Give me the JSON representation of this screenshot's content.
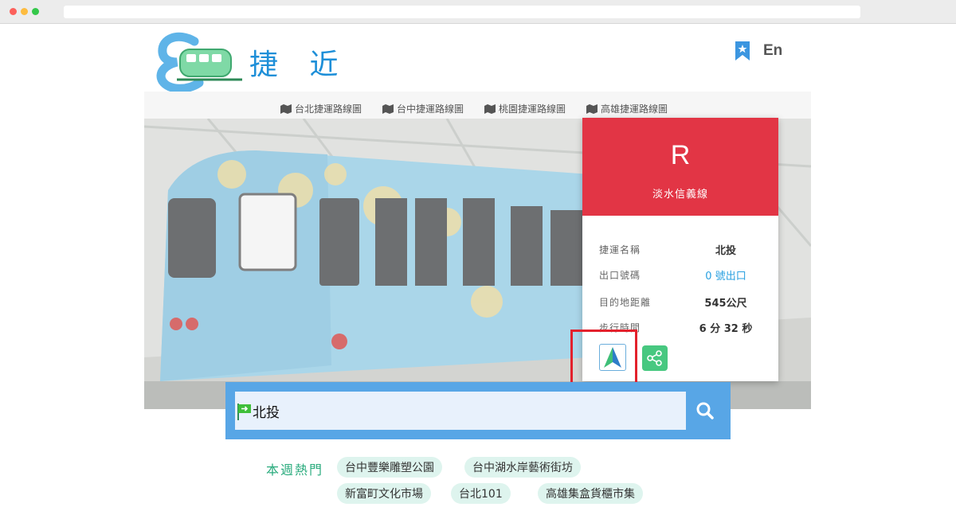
{
  "header": {
    "logo_text": "捷 近",
    "lang_label": "En"
  },
  "nav": {
    "links": [
      "台北捷運路線圖",
      "台中捷運路線圖",
      "桃園捷運路線圖",
      "高雄捷運路線圖"
    ]
  },
  "card": {
    "line_letter": "R",
    "line_name": "淡水信義線",
    "rows": [
      {
        "label": "捷運名稱",
        "value": "北投"
      },
      {
        "label": "出口號碼",
        "value": "0 號出口"
      },
      {
        "label": "目的地距離",
        "value": "545公尺"
      },
      {
        "label": "步行時間",
        "value": "6 分 32 秒"
      }
    ],
    "header_color": "#e23545"
  },
  "search": {
    "value": "北投"
  },
  "hot": {
    "label": "本週熱門",
    "tags": [
      "台中豐樂雕塑公園",
      "台中湖水岸藝術街坊",
      "新富町文化市場",
      "台北101",
      "高雄集盒貨櫃市集"
    ]
  },
  "colors": {
    "accent_blue": "#1e8fd8",
    "search_blue": "#58a6e6",
    "highlight_red": "#e3212c",
    "share_green": "#47c880"
  },
  "icons": {
    "bookmark": "bookmark-icon",
    "map": "map-icon",
    "navigate": "navigation-arrow-icon",
    "share": "share-icon",
    "search": "search-icon",
    "flag": "start-flag-icon"
  }
}
